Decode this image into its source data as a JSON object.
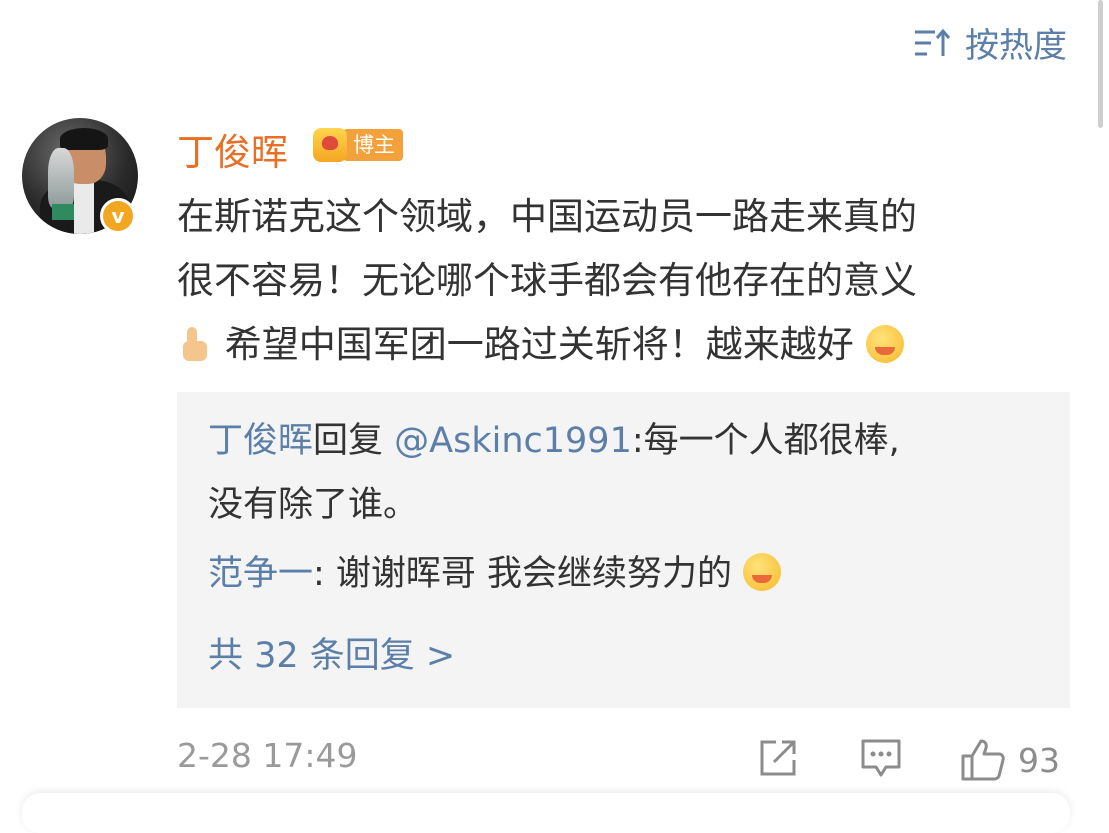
{
  "sort": {
    "label": "按热度",
    "icon": "sort-icon"
  },
  "comment": {
    "author": "丁俊晖",
    "role_badge": "博主",
    "verified_icon": "v",
    "lines": [
      "在斯诺克这个领域，中国运动员一路走来真的",
      "很不容易！无论哪个球手都会有他存在的意义",
      "希望中国军团一路过关斩将！越来越好"
    ],
    "timestamp": "2-28 17:49",
    "like_count": "93"
  },
  "replies": {
    "reply1": {
      "author": "丁俊晖",
      "verb": "回复",
      "mention": "@Askinc1991",
      "text_line1": ":每一个人都很棒,",
      "text_line2": "没有除了谁。"
    },
    "reply2": {
      "author": "范争一",
      "text": ": 谢谢晖哥 我会继续努力的"
    },
    "more_label": "共 32 条回复 >"
  },
  "colors": {
    "author": "#e86f23",
    "link": "#5b7fa8",
    "reply_bg": "#f4f4f4",
    "meta": "#9a9a9a"
  }
}
